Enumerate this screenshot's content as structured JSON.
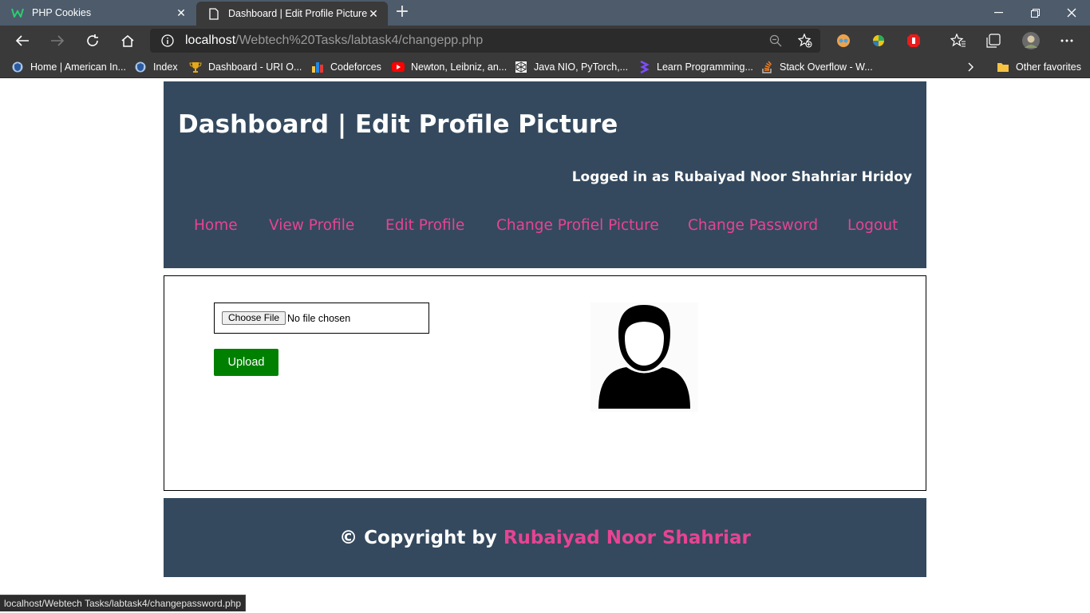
{
  "browser": {
    "tabs": [
      {
        "title": "PHP Cookies",
        "active": false
      },
      {
        "title": "Dashboard | Edit Profile Picture",
        "active": true
      }
    ],
    "url": {
      "host": "localhost",
      "path": "/Webtech%20Tasks/labtask4/changepp.php"
    },
    "bookmarks": [
      {
        "label": "Home | American In...",
        "icon": "shield-icon"
      },
      {
        "label": "Index",
        "icon": "shield-icon"
      },
      {
        "label": "Dashboard - URI O...",
        "icon": "trophy-icon"
      },
      {
        "label": "Codeforces",
        "icon": "codeforces-icon"
      },
      {
        "label": "Newton, Leibniz, an...",
        "icon": "youtube-icon"
      },
      {
        "label": "Java NIO, PyTorch,...",
        "icon": "cube-icon"
      },
      {
        "label": "Learn Programming...",
        "icon": "learn-icon"
      },
      {
        "label": "Stack Overflow - W...",
        "icon": "stackoverflow-icon"
      }
    ],
    "other_favorites": "Other favorites",
    "status_url": "localhost/Webtech Tasks/labtask4/changepassword.php"
  },
  "header": {
    "title": "Dashboard | Edit Profile Picture",
    "logged_in": "Logged in as Rubaiyad Noor Shahriar Hridoy",
    "nav": [
      "Home",
      "View Profile",
      "Edit Profile",
      "Change Profiel Picture",
      "Change Password",
      "Logout"
    ]
  },
  "upload": {
    "choose_label": "Choose File",
    "file_status": "No file chosen",
    "upload_label": "Upload"
  },
  "footer": {
    "copyright_prefix": "© Copyright by",
    "copyright_name": "Rubaiyad Noor Shahriar"
  },
  "colors": {
    "header_bg": "#34495e",
    "accent": "#e84393",
    "upload_btn": "#008000"
  }
}
